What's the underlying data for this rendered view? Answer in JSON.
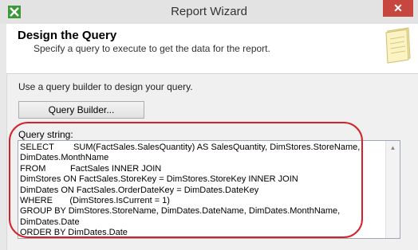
{
  "window": {
    "title": "Report Wizard",
    "close_label": "✕",
    "app_icon": "report-wizard-icon"
  },
  "header": {
    "title": "Design the Query",
    "subtitle": "Specify a query to execute to get the data for the report.",
    "icon": "notepad-icon"
  },
  "body": {
    "instruction": "Use a query builder to design your query.",
    "query_builder_label": "Query Builder...",
    "query_string_label": "Query string:",
    "query_string": "SELECT        SUM(FactSales.SalesQuantity) AS SalesQuantity, DimStores.StoreName, DimDates.MonthName\nFROM          FactSales INNER JOIN\nDimStores ON FactSales.StoreKey = DimStores.StoreKey INNER JOIN\nDimDates ON FactSales.OrderDateKey = DimDates.DateKey\nWHERE       (DimStores.IsCurrent = 1)\nGROUP BY DimStores.StoreName, DimDates.DateName, DimDates.MonthName, DimDates.Date\nORDER BY DimDates.Date"
  },
  "colors": {
    "highlight": "#d4222b",
    "close_button": "#c7463f"
  }
}
